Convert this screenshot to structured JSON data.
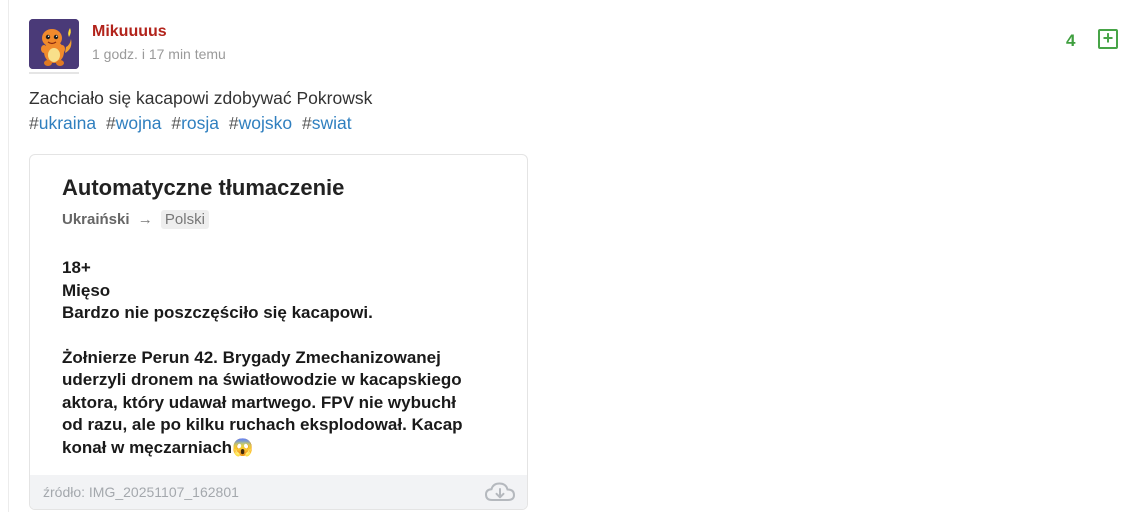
{
  "post": {
    "author": "Mikuuuus",
    "time": "1 godz. i 17 min temu",
    "vote_count": "4",
    "plus_label": "+",
    "text": "Zachciało się kacapowi zdobywać Pokrowsk",
    "tags": [
      "ukraina",
      "wojna",
      "rosja",
      "wojsko",
      "swiat"
    ]
  },
  "embed": {
    "title": "Automatyczne tłumaczenie",
    "lang_from": "Ukraiński",
    "lang_arrow": "→",
    "lang_to": "Polski",
    "line1": "18+",
    "line2": "Mięso",
    "line3": "Bardzo nie poszczęściło się kacapowi.",
    "para2_l1": "Żołnierze Perun 42. Brygady Zmechanizowanej",
    "para2_l2": "uderzyli dronem na światłowodzie w kacapskiego",
    "para2_l3": "aktora, który udawał martwego. FPV nie wybuchł",
    "para2_l4": "od razu, ale po kilku ruchach eksplodował. Kacap",
    "para2_l5": "konał w męczarniach😱",
    "source": "źródło: IMG_20251107_162801"
  },
  "icons": {
    "avatar": "charmander-avatar",
    "download": "cloud-download-icon",
    "plus": "plus-square-icon"
  },
  "colors": {
    "username": "#b2231b",
    "vote": "#3f9f3f",
    "tag": "#2f7fbf"
  }
}
